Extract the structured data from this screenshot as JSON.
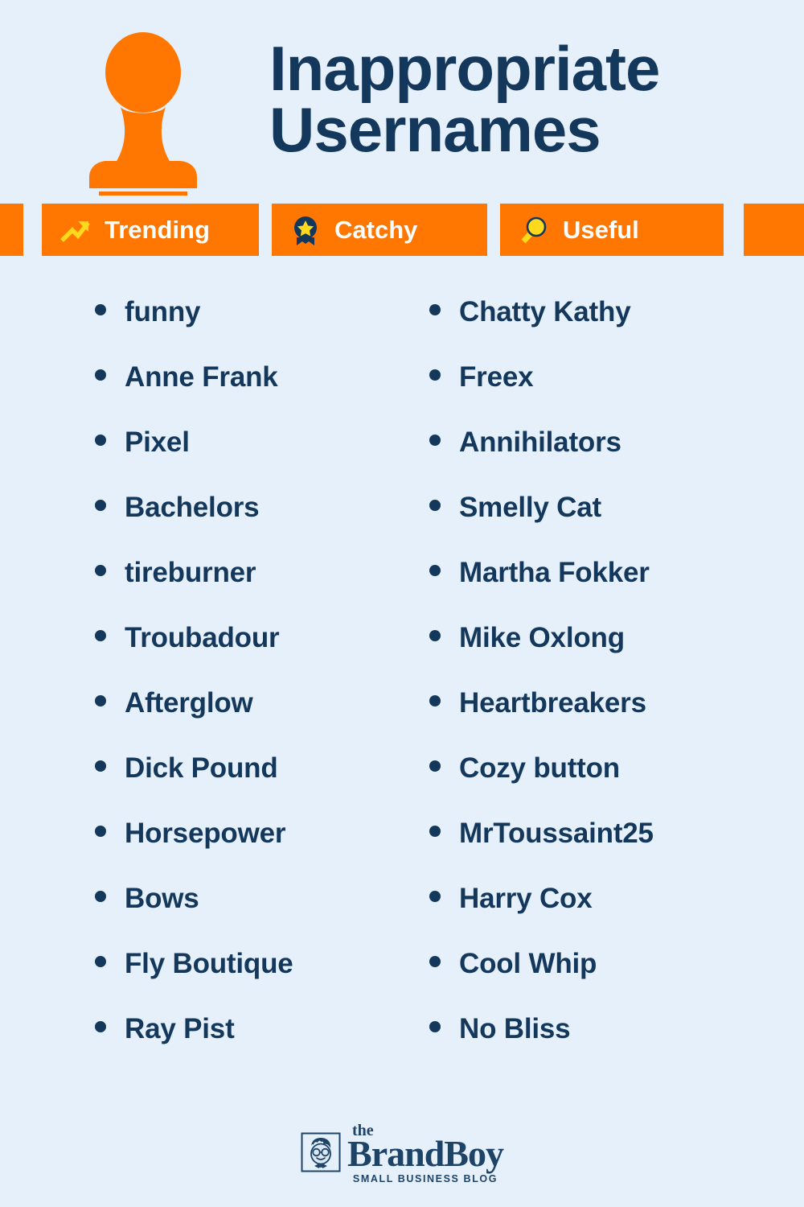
{
  "page": {
    "background_color": "#e6f0fb",
    "accent_orange": "#ff7700",
    "navy": "#14385c",
    "yellow": "#ffd91c"
  },
  "header": {
    "icon": "rubber-stamp-icon",
    "title_line_1": "Inappropriate",
    "title_line_2": "Usernames"
  },
  "badges": [
    {
      "icon": "trending-arrow-icon",
      "label": "Trending"
    },
    {
      "icon": "award-ribbon-star-icon",
      "label": "Catchy"
    },
    {
      "icon": "magnifying-glass-icon",
      "label": "Useful"
    }
  ],
  "lists": {
    "left_column": [
      "funny",
      "Anne Frank",
      "Pixel",
      "Bachelors",
      "tireburner",
      "Troubadour",
      "Afterglow",
      "Dick Pound",
      "Horsepower",
      "Bows",
      "Fly Boutique",
      "Ray Pist"
    ],
    "right_column": [
      "Chatty Kathy",
      "Freex",
      "Annihilators",
      "Smelly Cat",
      "Martha Fokker",
      "Mike Oxlong",
      "Heartbreakers",
      "Cozy button",
      "MrToussaint25",
      "Harry Cox",
      "Cool Whip",
      "No Bliss"
    ]
  },
  "footer": {
    "logo_mark": "boy-with-glasses-icon",
    "logo_the": "the",
    "logo_name": "BrandBoy",
    "logo_tagline": "SMALL BUSINESS BLOG"
  }
}
